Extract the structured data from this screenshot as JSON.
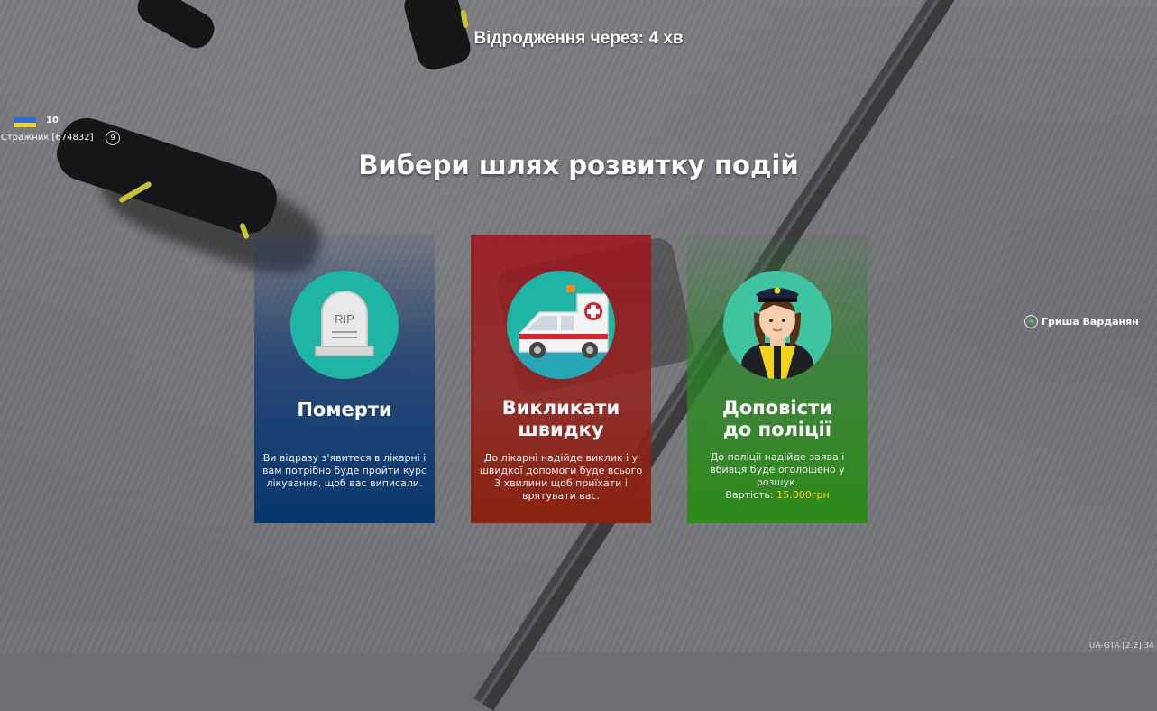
{
  "hud": {
    "respawn_label": "Відродження через:",
    "respawn_value": "4",
    "respawn_unit": "хв",
    "headline": "Вибери шлях розвитку подій"
  },
  "player": {
    "level": "10",
    "name": "Стражник [674832]",
    "badge": "9",
    "flag_colors": [
      "#2d6fd6",
      "#f2d21b"
    ]
  },
  "npc": {
    "name": "Гриша Варданян",
    "marker_color": "#3fd46b"
  },
  "options": [
    {
      "title": "Померти",
      "description": "Ви відразу з'явитеся в лікарні і вам потрібно буде пройти курс лікування, щоб вас виписали.",
      "icon": "tombstone-icon",
      "icon_text": "RIP",
      "color": "#06376e"
    },
    {
      "title_line1": "Викликати",
      "title_line2": "швидку",
      "description": "До лікарні надійде виклик і у швидкої допомоги буде всього 3 хвилини щоб приїхати і врятувати вас.",
      "icon": "ambulance-icon",
      "color": "#a01a1e"
    },
    {
      "title_line1": "Доповісти",
      "title_line2": "до поліції",
      "description": "До поліції надійде заява і вбивця буде оголошено у розшук.",
      "price_label": "Вартість:",
      "price_value": "15.000грн",
      "icon": "police-officer-icon",
      "color": "#2d8a19"
    }
  ],
  "footer": {
    "version": "UA-GTA [2.2] 34"
  },
  "colors": {
    "icon_circle": "#1fb5a6",
    "price": "#f3d51f"
  }
}
